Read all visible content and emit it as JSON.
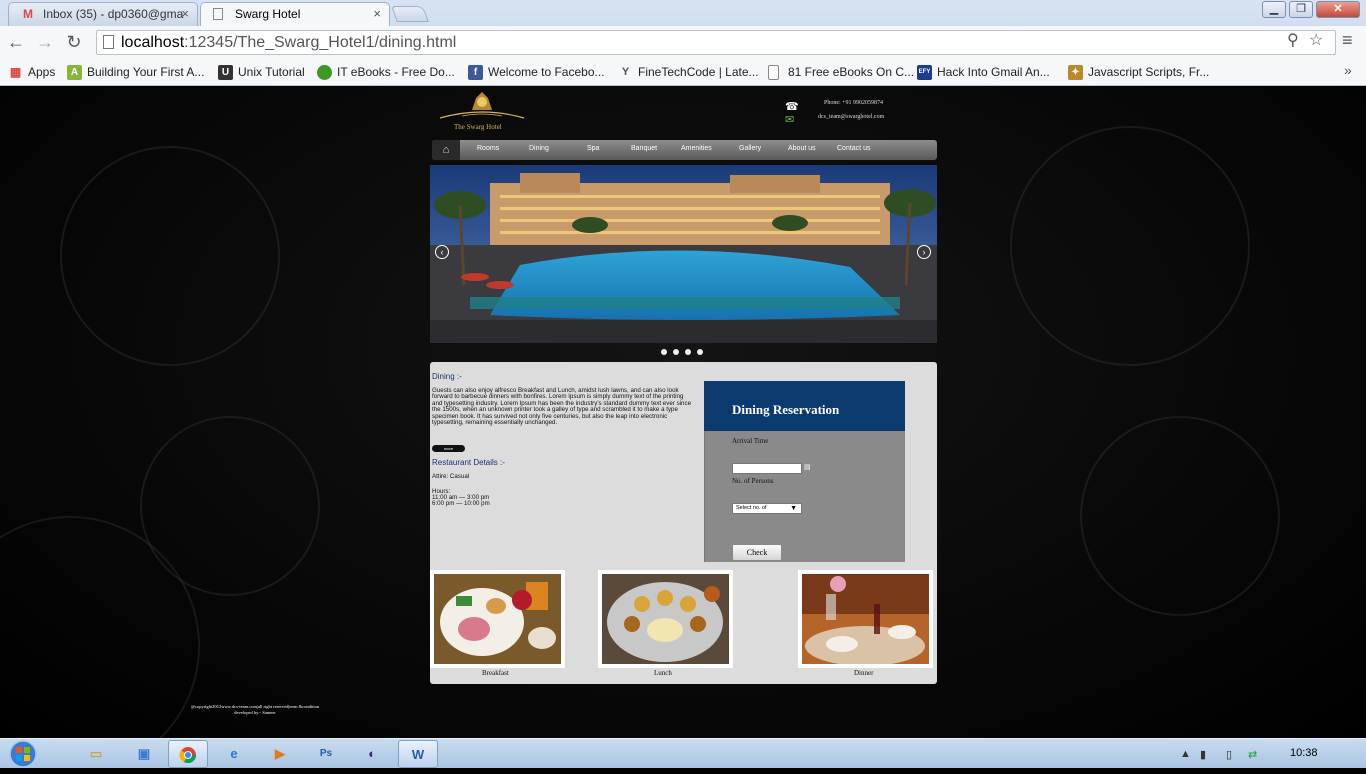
{
  "browser": {
    "tabs": [
      {
        "title": "Inbox (35) - dp0360@gma",
        "icon": "gmail-icon",
        "close": "×"
      },
      {
        "title": "Swarg Hotel",
        "icon": "page-icon",
        "close": "×"
      }
    ],
    "url_host": "localhost",
    "url_path": ":12345/The_Swarg_Hotel1/dining.html",
    "bookmarks": [
      {
        "label": "Apps",
        "icon": "apps-grid-icon",
        "color": "#d44"
      },
      {
        "label": "Building Your First A...",
        "icon": "android-icon",
        "color": "#8ab53c"
      },
      {
        "label": "Unix Tutorial",
        "icon": "unix-icon",
        "color": "#333333"
      },
      {
        "label": "IT eBooks - Free Do...",
        "icon": "green-ball-icon",
        "color": "#3c9a24"
      },
      {
        "label": "Welcome to Facebo...",
        "icon": "facebook-icon",
        "color": "#3b5998"
      },
      {
        "label": "FineTechCode | Late...",
        "icon": "ftc-icon",
        "color": "#555555"
      },
      {
        "label": "81 Free eBooks On C...",
        "icon": "page-icon",
        "color": "#ffffff"
      },
      {
        "label": "Hack Into Gmail An...",
        "icon": "efy-icon",
        "color": "#1d3c8f"
      },
      {
        "label": "Javascript Scripts, Fr...",
        "icon": "script-icon",
        "color": "#b88a2a"
      }
    ],
    "more": "»"
  },
  "site": {
    "logo_text": "The Swarg Hotel",
    "phone": "Phone: +91 9902059874",
    "email": "dcs_team@swarghotel.com",
    "nav": [
      "Rooms",
      "Dining",
      "Spa",
      "Banquet",
      "Amenities",
      "Gallery",
      "About us",
      "Contact us"
    ],
    "slider": {
      "prev": "‹",
      "next": "›",
      "dots": 4,
      "active_dot": 0
    }
  },
  "content": {
    "dining_title": "Dining :-",
    "dining_text": "Guests can also enjoy alfresco Breakfast and Lunch, amidst lush lawns, and can also look forward to barbecue dinners with bonfires. Lorem Ipsum is simply dummy text of the printing and typesetting industry. Lorem Ipsum has been the industry's standard dummy text ever since the 1500s, when an unknown printer took a galley of type and scrambled it to make a type specimen book. It has survived not only five centuries, but also the leap into electronic typesetting, remaining essentially unchanged.",
    "more_label": "more",
    "restaurant_title": "Restaurant Details :-",
    "attire": "Attire: Casual",
    "hours_label": "Hours:",
    "hours_1": "11:00 am — 3:00 pm",
    "hours_2": "6:00 pm — 10:00 pm",
    "reservation": {
      "title": "Dining Reservation",
      "arrival_label": "Arrival Time",
      "persons_label": "No. of Persons",
      "persons_placeholder": "Select no. of",
      "check_label": "Check"
    },
    "meals": [
      "Breakfast",
      "Lunch",
      "Dinner"
    ]
  },
  "footer": {
    "line1": "@copyright2012www.dcs-team.com|all right reserved|term &condition",
    "line2": "developed by:- Sameer"
  },
  "taskbar": {
    "clock": "10:38",
    "apps": [
      "explorer-icon",
      "windows-explorer-icon",
      "chrome-icon",
      "ie-icon",
      "media-player-icon",
      "photoshop-icon",
      "eclipse-icon",
      "word-icon"
    ]
  }
}
